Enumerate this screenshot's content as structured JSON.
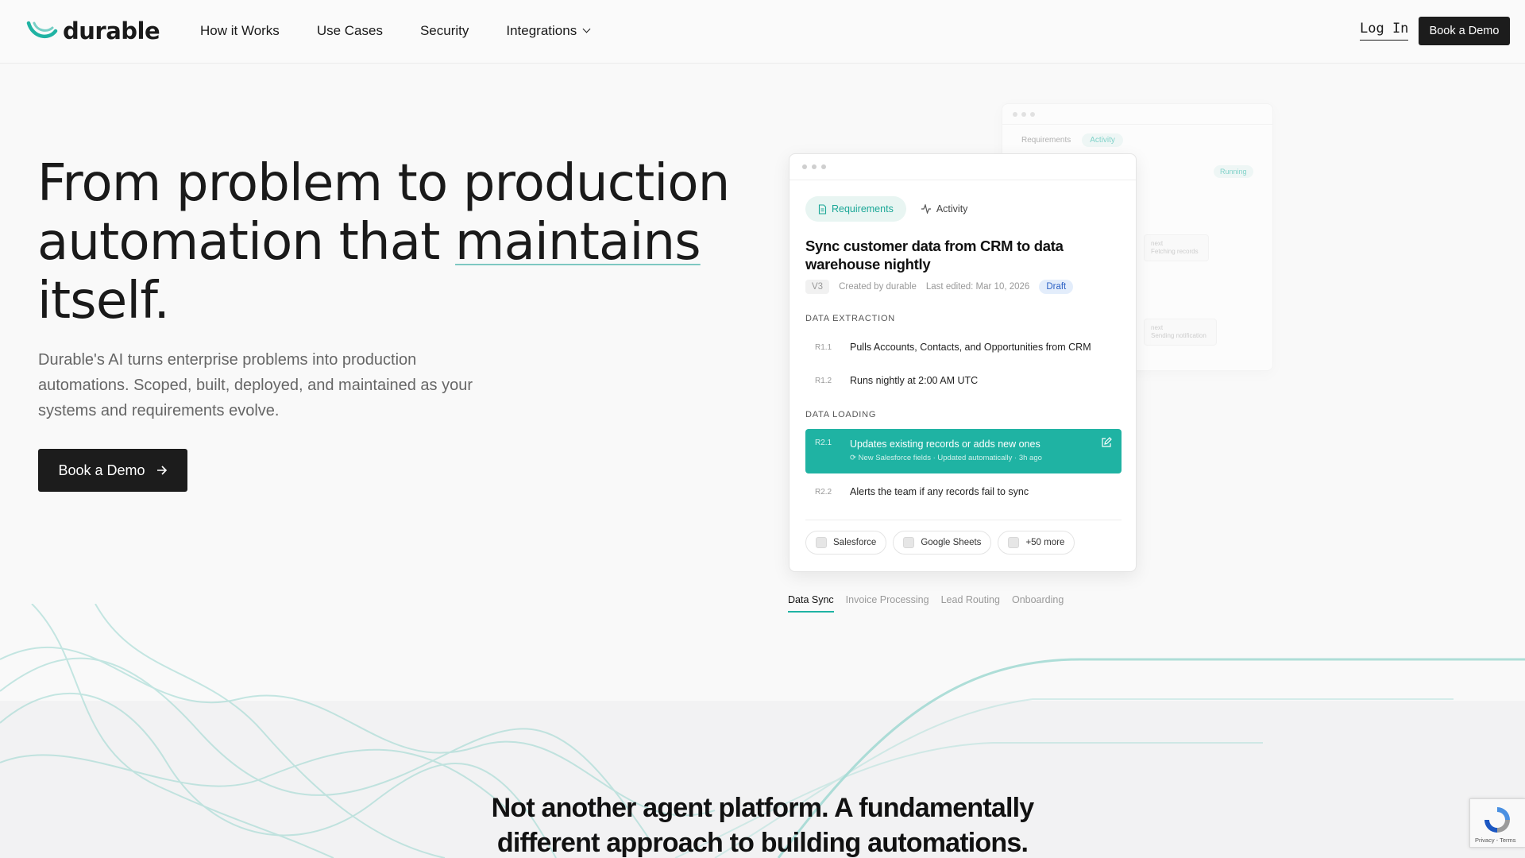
{
  "nav": {
    "brand": "durable",
    "links": [
      "How it Works",
      "Use Cases",
      "Security",
      "Integrations"
    ],
    "login": "Log In",
    "cta": "Book a Demo"
  },
  "hero": {
    "title_line1": "From problem to production",
    "title_line2_a": "automation that ",
    "title_line2_accent": "maintains",
    "title_line3": "itself.",
    "subtitle": "Durable's AI turns enterprise problems into production automations. Scoped, built, deployed, and maintained as your systems and requirements evolve.",
    "cta": "Book a Demo"
  },
  "back_card": {
    "tabs": [
      "Requirements",
      "Activity"
    ],
    "status": "Running",
    "step1_label": "next",
    "step1_text": "Fetching records",
    "step2_label": "next",
    "step2_text": "Sending notification"
  },
  "card": {
    "tabs": [
      "Requirements",
      "Activity"
    ],
    "title": "Sync customer data from CRM to data warehouse nightly",
    "version": "V3",
    "created_by": "Created by durable",
    "last_edited": "Last edited: Mar 10, 2026",
    "status": "Draft",
    "sections": [
      {
        "label": "DATA EXTRACTION",
        "items": [
          {
            "id": "R1.1",
            "text": "Pulls Accounts, Contacts, and Opportunities from CRM"
          },
          {
            "id": "R1.2",
            "text": "Runs nightly at 2:00 AM UTC"
          }
        ]
      },
      {
        "label": "DATA LOADING",
        "items": [
          {
            "id": "R2.1",
            "text": "Updates existing records or adds new ones",
            "sub": "New Salesforce fields · Updated automatically · 3h ago"
          },
          {
            "id": "R2.2",
            "text": "Alerts the team if any records fail to sync"
          }
        ]
      }
    ],
    "integrations": [
      "Salesforce",
      "Google Sheets",
      "+50 more"
    ]
  },
  "use_cases": [
    "Data Sync",
    "Invoice Processing",
    "Lead Routing",
    "Onboarding"
  ],
  "bottom": {
    "title_line1": "Not another agent platform. A fundamentally",
    "title_line2": "different approach to building automations."
  },
  "recaptcha": {
    "text": "Privacy - Terms"
  },
  "colors": {
    "accent": "#1fb3a3",
    "dark_button": "#1c1c1c",
    "draft_badge": "#2e62c5"
  }
}
